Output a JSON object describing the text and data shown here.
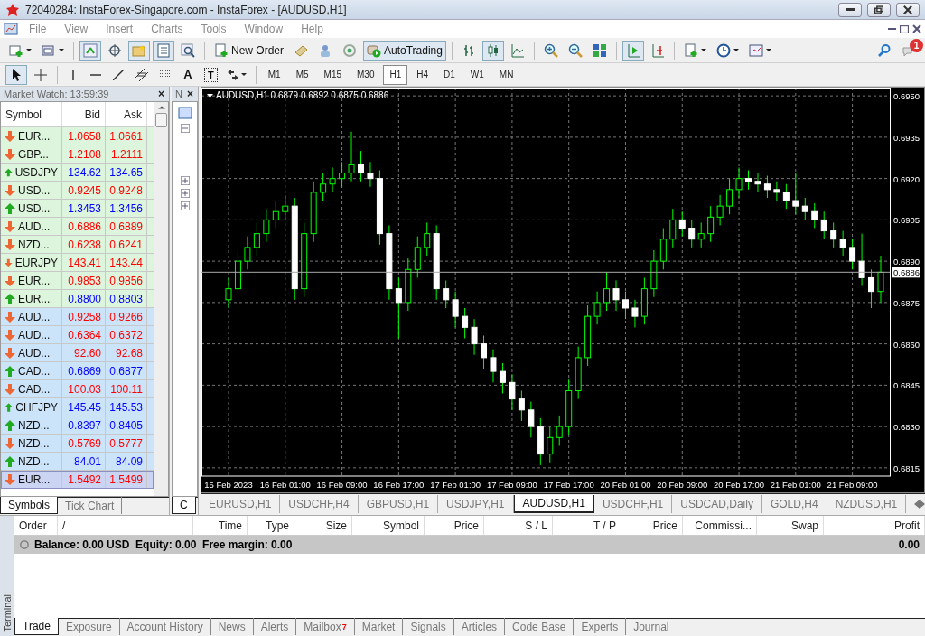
{
  "window": {
    "title": "72040284: InstaForex-Singapore.com - InstaForex - [AUDUSD,H1]"
  },
  "menu": [
    "File",
    "View",
    "Insert",
    "Charts",
    "Tools",
    "Window",
    "Help"
  ],
  "toolbar": {
    "new_order": "New Order",
    "auto_trading": "AutoTrading",
    "notifications": "1"
  },
  "drawing_tools": {
    "text_tool": "A",
    "label_tool": "T"
  },
  "timeframes": [
    {
      "label": "M1",
      "selected": false
    },
    {
      "label": "M5",
      "selected": false
    },
    {
      "label": "M15",
      "selected": false
    },
    {
      "label": "M30",
      "selected": false
    },
    {
      "label": "H1",
      "selected": true
    },
    {
      "label": "H4",
      "selected": false
    },
    {
      "label": "D1",
      "selected": false
    },
    {
      "label": "W1",
      "selected": false
    },
    {
      "label": "MN",
      "selected": false
    }
  ],
  "market_watch": {
    "title": "Market Watch: 13:59:39",
    "close": "×",
    "columns": [
      "Symbol",
      "Bid",
      "Ask"
    ],
    "rows": [
      {
        "symbol": "EUR...",
        "bid": "1.0658",
        "ask": "1.0661",
        "rising": false,
        "color": "#dcf5dc",
        "selected": false
      },
      {
        "symbol": "GBP...",
        "bid": "1.2108",
        "ask": "1.2111",
        "rising": false,
        "color": "#dcf5dc",
        "selected": false
      },
      {
        "symbol": "USDJPY",
        "bid": "134.62",
        "ask": "134.65",
        "rising": true,
        "color": "#dcf5dc",
        "selected": false
      },
      {
        "symbol": "USD...",
        "bid": "0.9245",
        "ask": "0.9248",
        "rising": false,
        "color": "#dcf5dc",
        "selected": false
      },
      {
        "symbol": "USD...",
        "bid": "1.3453",
        "ask": "1.3456",
        "rising": true,
        "color": "#dcf5dc",
        "selected": false
      },
      {
        "symbol": "AUD...",
        "bid": "0.6886",
        "ask": "0.6889",
        "rising": false,
        "color": "#dcf5dc",
        "selected": false
      },
      {
        "symbol": "NZD...",
        "bid": "0.6238",
        "ask": "0.6241",
        "rising": false,
        "color": "#dcf5dc",
        "selected": false
      },
      {
        "symbol": "EURJPY",
        "bid": "143.41",
        "ask": "143.44",
        "rising": false,
        "color": "#dcf5dc",
        "selected": false
      },
      {
        "symbol": "EUR...",
        "bid": "0.9853",
        "ask": "0.9856",
        "rising": false,
        "color": "#dcf5dc",
        "selected": false
      },
      {
        "symbol": "EUR...",
        "bid": "0.8800",
        "ask": "0.8803",
        "rising": true,
        "color": "#dcf5dc",
        "selected": false
      },
      {
        "symbol": "AUD...",
        "bid": "0.9258",
        "ask": "0.9266",
        "rising": false,
        "color": "#cce4fa",
        "selected": false
      },
      {
        "symbol": "AUD...",
        "bid": "0.6364",
        "ask": "0.6372",
        "rising": false,
        "color": "#cce4fa",
        "selected": false
      },
      {
        "symbol": "AUD...",
        "bid": "92.60",
        "ask": "92.68",
        "rising": false,
        "color": "#cce4fa",
        "selected": false
      },
      {
        "symbol": "CAD...",
        "bid": "0.6869",
        "ask": "0.6877",
        "rising": true,
        "color": "#cce4fa",
        "selected": false
      },
      {
        "symbol": "CAD...",
        "bid": "100.03",
        "ask": "100.11",
        "rising": false,
        "color": "#cce4fa",
        "selected": false
      },
      {
        "symbol": "CHFJPY",
        "bid": "145.45",
        "ask": "145.53",
        "rising": true,
        "color": "#cce4fa",
        "selected": false
      },
      {
        "symbol": "NZD...",
        "bid": "0.8397",
        "ask": "0.8405",
        "rising": true,
        "color": "#cce4fa",
        "selected": false
      },
      {
        "symbol": "NZD...",
        "bid": "0.5769",
        "ask": "0.5777",
        "rising": false,
        "color": "#cce4fa",
        "selected": false
      },
      {
        "symbol": "NZD...",
        "bid": "84.01",
        "ask": "84.09",
        "rising": true,
        "color": "#cce4fa",
        "selected": false
      },
      {
        "symbol": "EUR...",
        "bid": "1.5492",
        "ask": "1.5499",
        "rising": false,
        "color": "#ccd4f4",
        "selected": true
      }
    ],
    "tabs": [
      {
        "label": "Symbols",
        "selected": true
      },
      {
        "label": "Tick Chart",
        "selected": false
      }
    ]
  },
  "navigator": {
    "title": "N",
    "close": "×",
    "tab": "C"
  },
  "chart": {
    "symbol": "AUDUSD,H1",
    "ohlc": [
      "0.6879",
      "0.6892",
      "0.6875",
      "0.6886"
    ],
    "current_price": "0.6886",
    "chart_data": {
      "type": "candlestick",
      "categories": [
        "15 Feb 2023",
        null,
        null,
        null,
        null,
        null,
        "16 Feb 01:00",
        null,
        null,
        null,
        null,
        null,
        "16 Feb 09:00",
        null,
        null,
        null,
        null,
        null,
        "16 Feb 17:00",
        null,
        null,
        null,
        null,
        null,
        "17 Feb 01:00",
        null,
        null,
        null,
        null,
        null,
        "17 Feb 09:00",
        null,
        null,
        null,
        null,
        null,
        "17 Feb 17:00",
        null,
        null,
        null,
        null,
        null,
        "20 Feb 01:00",
        null,
        null,
        null,
        null,
        null,
        "20 Feb 09:00",
        null,
        null,
        null,
        null,
        null,
        "20 Feb 17:00",
        null,
        null,
        null,
        null,
        null,
        "21 Feb 01:00",
        null,
        null,
        null,
        null,
        null,
        "21 Feb 09:00",
        null,
        null,
        null
      ],
      "ohlc": [
        [
          0.6876,
          0.6884,
          0.6873,
          0.688
        ],
        [
          0.688,
          0.6894,
          0.6877,
          0.689
        ],
        [
          0.689,
          0.6899,
          0.6887,
          0.6895
        ],
        [
          0.6895,
          0.6904,
          0.6892,
          0.69
        ],
        [
          0.69,
          0.6909,
          0.6897,
          0.6905
        ],
        [
          0.6905,
          0.6912,
          0.6902,
          0.6908
        ],
        [
          0.6908,
          0.6914,
          0.6905,
          0.691
        ],
        [
          0.691,
          0.6913,
          0.6876,
          0.688
        ],
        [
          0.688,
          0.6904,
          0.6877,
          0.69
        ],
        [
          0.69,
          0.6919,
          0.6897,
          0.6915
        ],
        [
          0.6915,
          0.6922,
          0.6912,
          0.6918
        ],
        [
          0.6918,
          0.6924,
          0.6915,
          0.692
        ],
        [
          0.692,
          0.6926,
          0.6917,
          0.6922
        ],
        [
          0.6922,
          0.6937,
          0.6919,
          0.6925
        ],
        [
          0.6925,
          0.693,
          0.6919,
          0.6922
        ],
        [
          0.6922,
          0.6926,
          0.6917,
          0.692
        ],
        [
          0.692,
          0.6923,
          0.6896,
          0.69
        ],
        [
          0.69,
          0.6903,
          0.6876,
          0.688
        ],
        [
          0.688,
          0.6884,
          0.6862,
          0.6875
        ],
        [
          0.6875,
          0.6891,
          0.6872,
          0.6887
        ],
        [
          0.6887,
          0.6899,
          0.6884,
          0.6895
        ],
        [
          0.6895,
          0.6904,
          0.6892,
          0.69
        ],
        [
          0.69,
          0.6903,
          0.6876,
          0.688
        ],
        [
          0.688,
          0.6883,
          0.6873,
          0.6876
        ],
        [
          0.6876,
          0.6879,
          0.6866,
          0.687
        ],
        [
          0.687,
          0.6873,
          0.6862,
          0.6866
        ],
        [
          0.6866,
          0.6869,
          0.6856,
          0.686
        ],
        [
          0.686,
          0.6863,
          0.6851,
          0.6855
        ],
        [
          0.6855,
          0.6858,
          0.6846,
          0.685
        ],
        [
          0.685,
          0.6853,
          0.6842,
          0.6846
        ],
        [
          0.6846,
          0.6849,
          0.6836,
          0.684
        ],
        [
          0.684,
          0.6843,
          0.6832,
          0.6836
        ],
        [
          0.6836,
          0.6839,
          0.6826,
          0.683
        ],
        [
          0.683,
          0.6833,
          0.6816,
          0.682
        ],
        [
          0.682,
          0.683,
          0.6817,
          0.6826
        ],
        [
          0.6826,
          0.6834,
          0.6823,
          0.683
        ],
        [
          0.683,
          0.6847,
          0.6827,
          0.6843
        ],
        [
          0.6843,
          0.6859,
          0.684,
          0.6855
        ],
        [
          0.6855,
          0.6874,
          0.6852,
          0.687
        ],
        [
          0.687,
          0.6879,
          0.6867,
          0.6875
        ],
        [
          0.6875,
          0.6886,
          0.6872,
          0.688
        ],
        [
          0.688,
          0.6883,
          0.6872,
          0.6876
        ],
        [
          0.6876,
          0.6879,
          0.6869,
          0.6873
        ],
        [
          0.6873,
          0.6876,
          0.6866,
          0.687
        ],
        [
          0.687,
          0.6884,
          0.6867,
          0.688
        ],
        [
          0.688,
          0.6894,
          0.6877,
          0.689
        ],
        [
          0.689,
          0.6902,
          0.6887,
          0.6898
        ],
        [
          0.6898,
          0.6909,
          0.6895,
          0.6905
        ],
        [
          0.6905,
          0.6908,
          0.6899,
          0.6902
        ],
        [
          0.6902,
          0.6905,
          0.6895,
          0.6898
        ],
        [
          0.6898,
          0.6904,
          0.6895,
          0.69
        ],
        [
          0.69,
          0.691,
          0.6897,
          0.6906
        ],
        [
          0.6906,
          0.6914,
          0.6903,
          0.691
        ],
        [
          0.691,
          0.692,
          0.6907,
          0.6916
        ],
        [
          0.6916,
          0.6924,
          0.6913,
          0.692
        ],
        [
          0.692,
          0.6923,
          0.6916,
          0.6919
        ],
        [
          0.6919,
          0.6922,
          0.6915,
          0.6918
        ],
        [
          0.6918,
          0.6921,
          0.6913,
          0.6916
        ],
        [
          0.6916,
          0.6919,
          0.6912,
          0.6915
        ],
        [
          0.6915,
          0.6918,
          0.6909,
          0.6912
        ],
        [
          0.6912,
          0.6922,
          0.6907,
          0.691
        ],
        [
          0.691,
          0.6913,
          0.6905,
          0.6908
        ],
        [
          0.6908,
          0.6911,
          0.6902,
          0.6905
        ],
        [
          0.6905,
          0.6908,
          0.6898,
          0.6901
        ],
        [
          0.6901,
          0.6904,
          0.6895,
          0.6898
        ],
        [
          0.6898,
          0.6901,
          0.6892,
          0.6895
        ],
        [
          0.6895,
          0.6898,
          0.6887,
          0.689
        ],
        [
          0.689,
          0.69,
          0.6881,
          0.6884
        ],
        [
          0.6884,
          0.6887,
          0.6873,
          0.6879
        ],
        [
          0.6879,
          0.6892,
          0.6875,
          0.6886
        ]
      ],
      "ylim": [
        0.6812,
        0.6953
      ],
      "grid": true,
      "ref_lines": [
        {
          "axis": "y",
          "value": 0.6886
        }
      ],
      "yticks": [
        {
          "value": 0.695,
          "label": "0.6950"
        },
        {
          "value": 0.6935,
          "label": "0.6935"
        },
        {
          "value": 0.692,
          "label": "0.6920"
        },
        {
          "value": 0.6905,
          "label": "0.6905"
        },
        {
          "value": 0.689,
          "label": "0.6890"
        },
        {
          "value": 0.6875,
          "label": "0.6875"
        },
        {
          "value": 0.686,
          "label": "0.6860"
        },
        {
          "value": 0.6845,
          "label": "0.6845"
        },
        {
          "value": 0.683,
          "label": "0.6830"
        },
        {
          "value": 0.6815,
          "label": "0.6815"
        }
      ]
    }
  },
  "chart_tabs": [
    {
      "label": "EURUSD,H1",
      "selected": false
    },
    {
      "label": "USDCHF,H4",
      "selected": false
    },
    {
      "label": "GBPUSD,H1",
      "selected": false
    },
    {
      "label": "USDJPY,H1",
      "selected": false
    },
    {
      "label": "AUDUSD,H1",
      "selected": true
    },
    {
      "label": "USDCHF,H1",
      "selected": false
    },
    {
      "label": "USDCAD,Daily",
      "selected": false
    },
    {
      "label": "GOLD,H4",
      "selected": false
    },
    {
      "label": "NZDUSD,H1",
      "selected": false
    }
  ],
  "terminal": {
    "label": "Terminal",
    "columns": [
      "Order",
      "/",
      "Time",
      "Type",
      "Size",
      "Symbol",
      "Price",
      "S / L",
      "T / P",
      "Price",
      "Commissi...",
      "Swap",
      "Profit"
    ],
    "balance": "Balance: 0.00 USD  Equity: 0.00  Free margin: 0.00",
    "profit": "0.00",
    "tabs": [
      {
        "label": "Trade",
        "selected": true
      },
      {
        "label": "Exposure",
        "selected": false
      },
      {
        "label": "Account History",
        "selected": false
      },
      {
        "label": "News",
        "selected": false
      },
      {
        "label": "Alerts",
        "selected": false
      },
      {
        "label": "Mailbox",
        "selected": false,
        "badge": "7"
      },
      {
        "label": "Market",
        "selected": false
      },
      {
        "label": "Signals",
        "selected": false
      },
      {
        "label": "Articles",
        "selected": false
      },
      {
        "label": "Code Base",
        "selected": false
      },
      {
        "label": "Experts",
        "selected": false
      },
      {
        "label": "Journal",
        "selected": false
      }
    ]
  }
}
